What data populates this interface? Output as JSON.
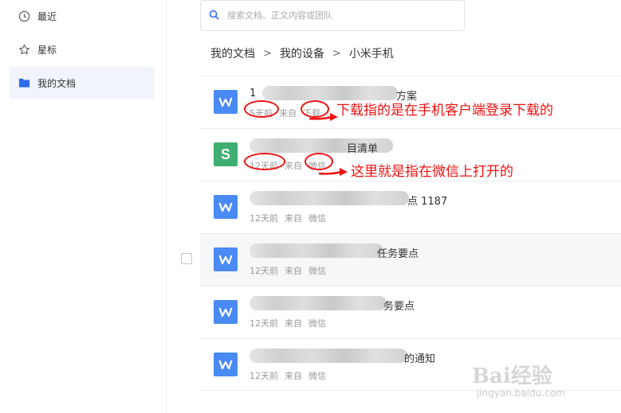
{
  "sidebar": {
    "items": [
      {
        "label": "最近",
        "icon": "clock-icon"
      },
      {
        "label": "星标",
        "icon": "star-icon"
      },
      {
        "label": "我的文档",
        "icon": "folder-icon",
        "active": true
      }
    ]
  },
  "search": {
    "placeholder": "搜索文档、正文内容或团队"
  },
  "breadcrumb": [
    "我的文档",
    "我的设备",
    "小米手机"
  ],
  "files": [
    {
      "title_suffix": "方案",
      "time": "5天前",
      "from": "来自",
      "source": "下载",
      "type": "W",
      "color": "#4a8af4"
    },
    {
      "title_suffix": "目清单",
      "time": "12天前",
      "from": "来自",
      "source": "微信",
      "type": "S",
      "color": "#3fae72"
    },
    {
      "title_suffix": "点 1187",
      "time": "12天前",
      "from": "来自",
      "source": "微信",
      "type": "W",
      "color": "#4a8af4"
    },
    {
      "title_suffix": "任务要点",
      "time": "12天前",
      "from": "来自",
      "source": "微信",
      "type": "W",
      "color": "#4a8af4"
    },
    {
      "title_suffix": "务要点",
      "time": "12天前",
      "from": "来自",
      "source": "微信",
      "type": "W",
      "color": "#4a8af4"
    },
    {
      "title_suffix": "的通知",
      "time": "12天前",
      "from": "来自",
      "source": "微信",
      "type": "W",
      "color": "#4a8af4"
    }
  ],
  "annotations": {
    "download": "下载指的是在手机客户端登录下载的",
    "wechat": "这里就是指在微信上打开的"
  },
  "watermark": {
    "text": "Bai经验",
    "url": "jingyan.baidu.com"
  }
}
